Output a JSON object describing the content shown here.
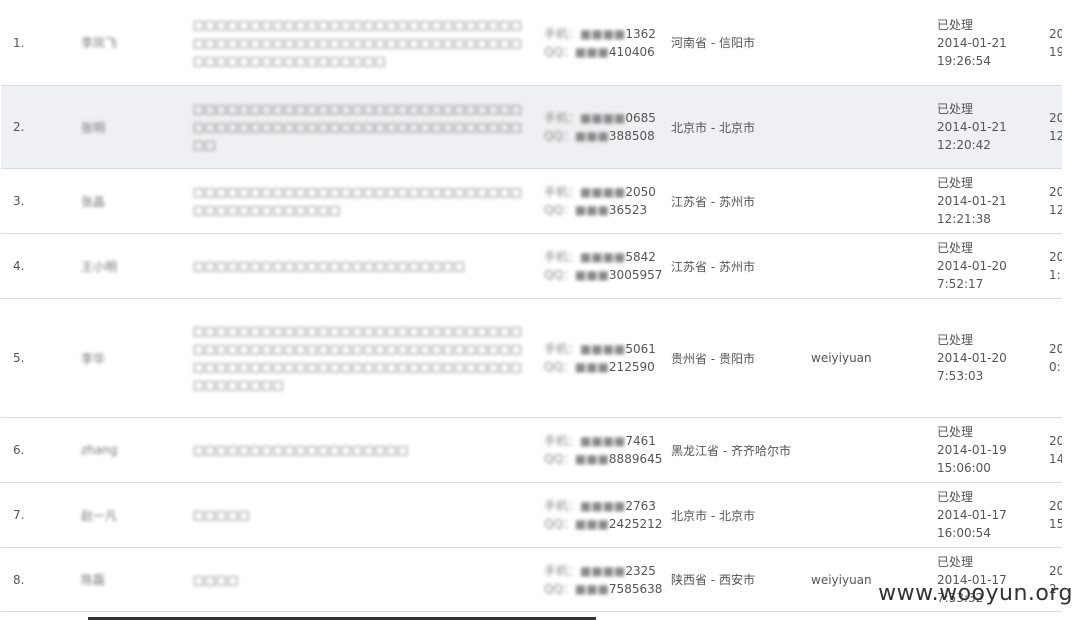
{
  "rows": [
    {
      "num": "1.",
      "name": "李凤飞",
      "message": "□□□□□□□□□□□□□□□□□□□□□□□□□□□□□□□□□□□□□□□□□□□□□□□□□□□□□□□□□□□□□□□□□□□□□□□□□□□",
      "phone1_mask": "手机：",
      "phone1_visible": "1362",
      "phone2_mask": "QQ：",
      "phone2_visible": "410406",
      "location": "河南省 - 信阳市",
      "user": "",
      "status": "已处理",
      "date": "2014-01-21",
      "time": "19:26:54",
      "last1": "20",
      "last2": "19",
      "alt": false
    },
    {
      "num": "2.",
      "name": "张明",
      "message": "□□□□□□□□□□□□□□□□□□□□□□□□□□□□□□□□□□□□□□□□□□□□□□□□□□□□□□□□□□□□",
      "phone1_mask": "手机：",
      "phone1_visible": "0685",
      "phone2_mask": "QQ：",
      "phone2_visible": "388508",
      "location": "北京市 - 北京市",
      "user": "",
      "status": "已处理",
      "date": "2014-01-21",
      "time": "12:20:42",
      "last1": "20",
      "last2": "12",
      "alt": true
    },
    {
      "num": "3.",
      "name": "张晶",
      "message": "□□□□□□□□□□□□□□□□□□□□□□□□□□□□□□□□□□□□□□□□□□",
      "phone1_mask": "手机：",
      "phone1_visible": "2050",
      "phone2_mask": "QQ：",
      "phone2_visible": "36523",
      "location": "江苏省 - 苏州市",
      "user": "",
      "status": "已处理",
      "date": "2014-01-21",
      "time": "12:21:38",
      "last1": "20",
      "last2": "12",
      "alt": false
    },
    {
      "num": "4.",
      "name": "王小明",
      "message": "□□□□□□□□□□□□□□□□□□□□□□□□",
      "phone1_mask": "手机：",
      "phone1_visible": "5842",
      "phone2_mask": "QQ：",
      "phone2_visible": "3005957",
      "location": "江苏省 - 苏州市",
      "user": "",
      "status": "已处理",
      "date": "2014-01-20",
      "time": "7:52:17",
      "last1": "20",
      "last2": "1:",
      "alt": false
    },
    {
      "num": "5.",
      "name": "李华",
      "message": "□□□□□□□□□□□□□□□□□□□□□□□□□□□□□□□□□□□□□□□□□□□□□□□□□□□□□□□□□□□□□□□□□□□□□□□□□□□□□□□□□□□□□□□□□□□□□□□",
      "phone1_mask": "手机：",
      "phone1_visible": "5061",
      "phone2_mask": "QQ：",
      "phone2_visible": "212590",
      "location": "贵州省 - 贵阳市",
      "user": "weiyiyuan",
      "status": "已处理",
      "date": "2014-01-20",
      "time": "7:53:03",
      "last1": "20",
      "last2": "0:",
      "alt": false
    },
    {
      "num": "6.",
      "name": "zhang",
      "message": "□□□□□□□□□□□□□□□□□□□",
      "phone1_mask": "手机：",
      "phone1_visible": "7461",
      "phone2_mask": "QQ：",
      "phone2_visible": "8889645",
      "location": "黑龙江省 - 齐齐哈尔市",
      "user": "",
      "status": "已处理",
      "date": "2014-01-19",
      "time": "15:06:00",
      "last1": "20",
      "last2": "14",
      "alt": false
    },
    {
      "num": "7.",
      "name": "赵一凡",
      "message": "□□□□□",
      "phone1_mask": "手机：",
      "phone1_visible": "2763",
      "phone2_mask": "QQ：",
      "phone2_visible": "2425212",
      "location": "北京市 - 北京市",
      "user": "",
      "status": "已处理",
      "date": "2014-01-17",
      "time": "16:00:54",
      "last1": "20",
      "last2": "15",
      "alt": false
    },
    {
      "num": "8.",
      "name": "陈磊",
      "message": "□□□□",
      "phone1_mask": "手机：",
      "phone1_visible": "2325",
      "phone2_mask": "QQ：",
      "phone2_visible": "7585638",
      "location": "陕西省 - 西安市",
      "user": "weiyiyuan",
      "status": "已处理",
      "date": "2014-01-17",
      "time": "7:53:32",
      "last1": "20",
      "last2": "2",
      "alt": false
    }
  ],
  "watermark": "www.wooyun.org"
}
